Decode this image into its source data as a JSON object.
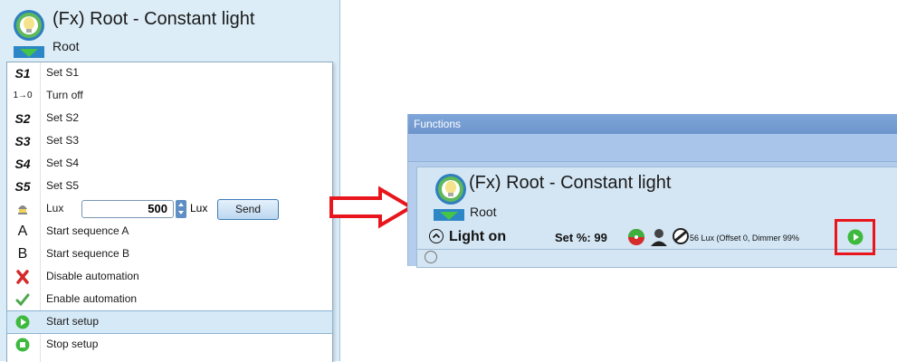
{
  "left": {
    "title": "(Fx) Root - Constant light",
    "subtitle": "Root",
    "menu": [
      {
        "icon": "S1",
        "label": "Set S1"
      },
      {
        "icon": "1→0",
        "label": "Turn off"
      },
      {
        "icon": "S2",
        "label": "Set S2"
      },
      {
        "icon": "S3",
        "label": "Set S3"
      },
      {
        "icon": "S4",
        "label": "Set S4"
      },
      {
        "icon": "S5",
        "label": "Set S5"
      },
      {
        "icon": "lamp-icon",
        "label": "Lux"
      },
      {
        "icon": "A",
        "label": "Start sequence A"
      },
      {
        "icon": "B",
        "label": "Start sequence B"
      },
      {
        "icon": "red-x-icon",
        "label": "Disable automation"
      },
      {
        "icon": "green-check-icon",
        "label": "Enable automation"
      },
      {
        "icon": "play-icon",
        "label": "Start setup"
      },
      {
        "icon": "stop-icon",
        "label": "Stop setup"
      }
    ],
    "lux": {
      "value": "500",
      "unit": "Lux",
      "send": "Send"
    }
  },
  "right": {
    "window_title": "Functions",
    "title": "(Fx) Root - Constant light",
    "subtitle": "Root",
    "status": "Light on",
    "set_percent": "Set %: 99",
    "info": "56 Lux (Offset 0, Dimmer 99%"
  },
  "colors": {
    "accent_red": "#e8161c",
    "play_green": "#3db93d",
    "selected_row": "#d6e9f7"
  }
}
